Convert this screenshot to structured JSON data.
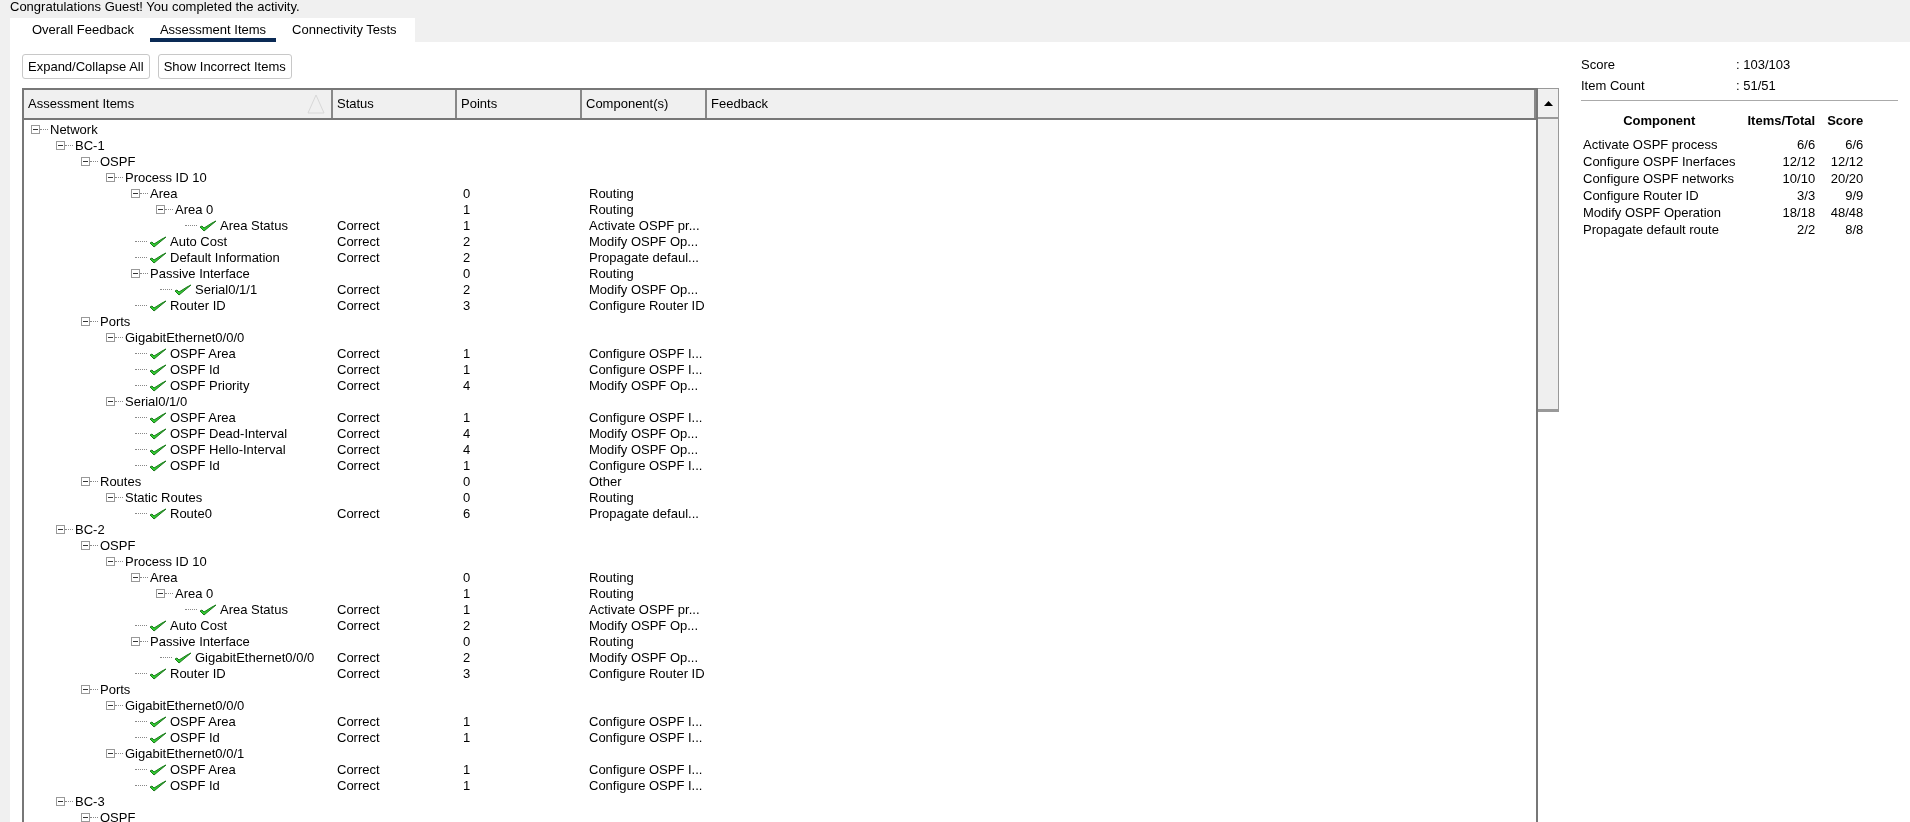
{
  "message": "Congratulations Guest! You completed the activity.",
  "tabs": [
    {
      "label": "Overall Feedback",
      "selected": false
    },
    {
      "label": "Assessment Items",
      "selected": true
    },
    {
      "label": "Connectivity Tests",
      "selected": false
    }
  ],
  "buttons": [
    "Expand/Collapse All",
    "Show Incorrect Items"
  ],
  "table": {
    "columns": [
      "Assessment Items",
      "Status",
      "Points",
      "Component(s)",
      "Feedback"
    ],
    "tree": [
      {
        "kind": "group",
        "label": "Network",
        "expanded": true,
        "children": [
          {
            "kind": "group",
            "label": "BC-1",
            "expanded": true,
            "children": [
              {
                "kind": "group",
                "label": "OSPF",
                "expanded": true,
                "children": [
                  {
                    "kind": "group",
                    "label": "Process ID 10",
                    "expanded": true,
                    "children": [
                      {
                        "kind": "group",
                        "label": "Area",
                        "expanded": true,
                        "points": "0",
                        "component": "Routing",
                        "children": [
                          {
                            "kind": "group",
                            "label": "Area 0",
                            "expanded": true,
                            "points": "1",
                            "component": "Routing",
                            "children": [
                              {
                                "kind": "item",
                                "label": "Area Status",
                                "passed": true,
                                "status": "Correct",
                                "points": "1",
                                "component": "Activate OSPF pr..."
                              }
                            ]
                          }
                        ]
                      },
                      {
                        "kind": "item",
                        "label": "Auto Cost",
                        "passed": true,
                        "status": "Correct",
                        "points": "2",
                        "component": "Modify OSPF Op..."
                      },
                      {
                        "kind": "item",
                        "label": "Default Information",
                        "passed": true,
                        "status": "Correct",
                        "points": "2",
                        "component": "Propagate defaul..."
                      },
                      {
                        "kind": "group",
                        "label": "Passive Interface",
                        "expanded": true,
                        "points": "0",
                        "component": "Routing",
                        "children": [
                          {
                            "kind": "item",
                            "label": "Serial0/1/1",
                            "passed": true,
                            "status": "Correct",
                            "points": "2",
                            "component": "Modify OSPF Op..."
                          }
                        ]
                      },
                      {
                        "kind": "item",
                        "label": "Router ID",
                        "passed": true,
                        "status": "Correct",
                        "points": "3",
                        "component": "Configure Router ID"
                      }
                    ]
                  }
                ]
              },
              {
                "kind": "group",
                "label": "Ports",
                "expanded": true,
                "children": [
                  {
                    "kind": "group",
                    "label": "GigabitEthernet0/0/0",
                    "expanded": true,
                    "children": [
                      {
                        "kind": "item",
                        "label": "OSPF Area",
                        "passed": true,
                        "status": "Correct",
                        "points": "1",
                        "component": "Configure OSPF I..."
                      },
                      {
                        "kind": "item",
                        "label": "OSPF Id",
                        "passed": true,
                        "status": "Correct",
                        "points": "1",
                        "component": "Configure OSPF I..."
                      },
                      {
                        "kind": "item",
                        "label": "OSPF Priority",
                        "passed": true,
                        "status": "Correct",
                        "points": "4",
                        "component": "Modify OSPF Op..."
                      }
                    ]
                  },
                  {
                    "kind": "group",
                    "label": "Serial0/1/0",
                    "expanded": true,
                    "children": [
                      {
                        "kind": "item",
                        "label": "OSPF Area",
                        "passed": true,
                        "status": "Correct",
                        "points": "1",
                        "component": "Configure OSPF I..."
                      },
                      {
                        "kind": "item",
                        "label": "OSPF Dead-Interval",
                        "passed": true,
                        "status": "Correct",
                        "points": "4",
                        "component": "Modify OSPF Op..."
                      },
                      {
                        "kind": "item",
                        "label": "OSPF Hello-Interval",
                        "passed": true,
                        "status": "Correct",
                        "points": "4",
                        "component": "Modify OSPF Op..."
                      },
                      {
                        "kind": "item",
                        "label": "OSPF Id",
                        "passed": true,
                        "status": "Correct",
                        "points": "1",
                        "component": "Configure OSPF I..."
                      }
                    ]
                  }
                ]
              },
              {
                "kind": "group",
                "label": "Routes",
                "expanded": true,
                "points": "0",
                "component": "Other",
                "children": [
                  {
                    "kind": "group",
                    "label": "Static Routes",
                    "expanded": true,
                    "points": "0",
                    "component": "Routing",
                    "children": [
                      {
                        "kind": "item",
                        "label": "Route0",
                        "passed": true,
                        "status": "Correct",
                        "points": "6",
                        "component": "Propagate defaul..."
                      }
                    ]
                  }
                ]
              }
            ]
          },
          {
            "kind": "group",
            "label": "BC-2",
            "expanded": true,
            "children": [
              {
                "kind": "group",
                "label": "OSPF",
                "expanded": true,
                "children": [
                  {
                    "kind": "group",
                    "label": "Process ID 10",
                    "expanded": true,
                    "children": [
                      {
                        "kind": "group",
                        "label": "Area",
                        "expanded": true,
                        "points": "0",
                        "component": "Routing",
                        "children": [
                          {
                            "kind": "group",
                            "label": "Area 0",
                            "expanded": true,
                            "points": "1",
                            "component": "Routing",
                            "children": [
                              {
                                "kind": "item",
                                "label": "Area Status",
                                "passed": true,
                                "status": "Correct",
                                "points": "1",
                                "component": "Activate OSPF pr..."
                              }
                            ]
                          }
                        ]
                      },
                      {
                        "kind": "item",
                        "label": "Auto Cost",
                        "passed": true,
                        "status": "Correct",
                        "points": "2",
                        "component": "Modify OSPF Op..."
                      },
                      {
                        "kind": "group",
                        "label": "Passive Interface",
                        "expanded": true,
                        "points": "0",
                        "component": "Routing",
                        "children": [
                          {
                            "kind": "item",
                            "label": "GigabitEthernet0/0/0",
                            "passed": true,
                            "status": "Correct",
                            "points": "2",
                            "component": "Modify OSPF Op..."
                          }
                        ]
                      },
                      {
                        "kind": "item",
                        "label": "Router ID",
                        "passed": true,
                        "status": "Correct",
                        "points": "3",
                        "component": "Configure Router ID"
                      }
                    ]
                  }
                ]
              },
              {
                "kind": "group",
                "label": "Ports",
                "expanded": true,
                "children": [
                  {
                    "kind": "group",
                    "label": "GigabitEthernet0/0/0",
                    "expanded": true,
                    "children": [
                      {
                        "kind": "item",
                        "label": "OSPF Area",
                        "passed": true,
                        "status": "Correct",
                        "points": "1",
                        "component": "Configure OSPF I..."
                      },
                      {
                        "kind": "item",
                        "label": "OSPF Id",
                        "passed": true,
                        "status": "Correct",
                        "points": "1",
                        "component": "Configure OSPF I..."
                      }
                    ]
                  },
                  {
                    "kind": "group",
                    "label": "GigabitEthernet0/0/1",
                    "expanded": true,
                    "children": [
                      {
                        "kind": "item",
                        "label": "OSPF Area",
                        "passed": true,
                        "status": "Correct",
                        "points": "1",
                        "component": "Configure OSPF I..."
                      },
                      {
                        "kind": "item",
                        "label": "OSPF Id",
                        "passed": true,
                        "status": "Correct",
                        "points": "1",
                        "component": "Configure OSPF I..."
                      }
                    ]
                  }
                ]
              }
            ]
          },
          {
            "kind": "group",
            "label": "BC-3",
            "expanded": true,
            "children": [
              {
                "kind": "group",
                "label": "OSPF",
                "expanded": true
              }
            ]
          }
        ]
      }
    ]
  },
  "summary": {
    "stats": [
      {
        "label": "Score",
        "value": ": 103/103"
      },
      {
        "label": "Item Count",
        "value": ": 51/51"
      }
    ],
    "columns": [
      "Component",
      "Items/Total",
      "Score"
    ],
    "rows": [
      [
        "Activate OSPF process",
        "6/6",
        "6/6"
      ],
      [
        "Configure OSPF Inerfaces",
        "12/12",
        "12/12"
      ],
      [
        "Configure OSPF networks",
        "10/10",
        "20/20"
      ],
      [
        "Configure Router ID",
        "3/3",
        "9/9"
      ],
      [
        "Modify OSPF Operation",
        "18/18",
        "48/48"
      ],
      [
        "Propagate default route",
        "2/2",
        "8/8"
      ]
    ]
  }
}
